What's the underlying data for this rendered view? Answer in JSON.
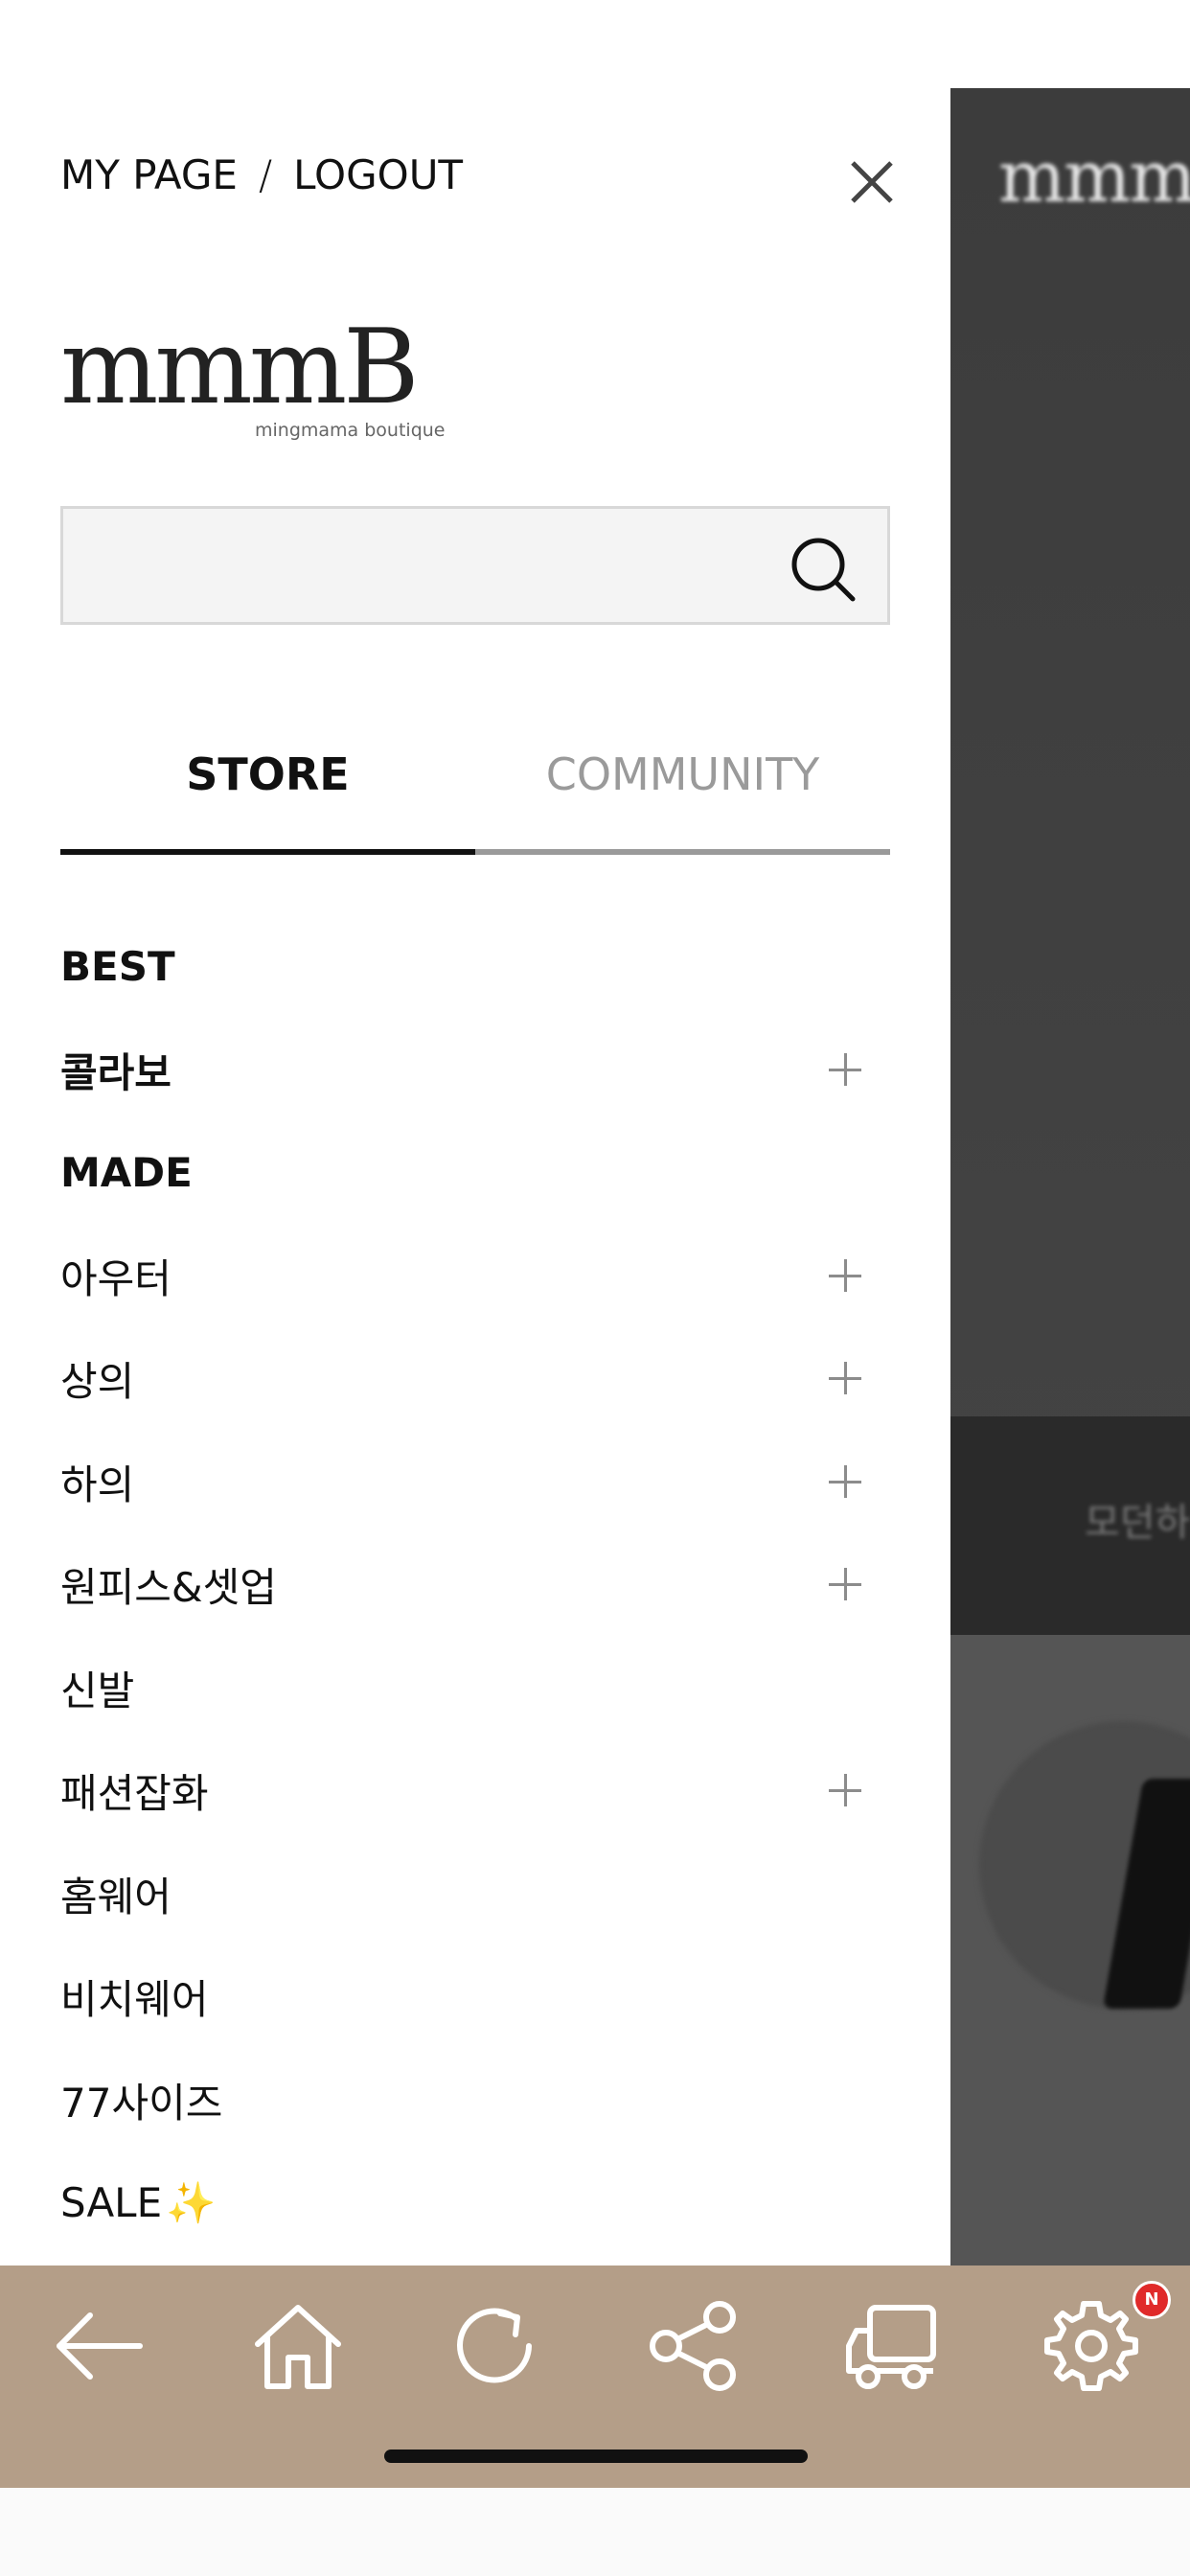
{
  "background_page": {
    "logo": "mmm",
    "band_text": "모던하"
  },
  "drawer": {
    "my_page": "MY PAGE",
    "separator": "/",
    "logout": "LOGOUT",
    "close_icon": "close-icon",
    "logo": {
      "main": "mmmB",
      "sub": "mingmama boutique"
    },
    "search": {
      "value": "",
      "placeholder": "",
      "icon": "search-icon"
    },
    "tabs": [
      {
        "label": "STORE",
        "active": true
      },
      {
        "label": "COMMUNITY",
        "active": false
      }
    ],
    "menu": [
      {
        "label": "BEST",
        "bold": true,
        "expandable": false
      },
      {
        "label": "콜라보",
        "bold": true,
        "expandable": true
      },
      {
        "label": "MADE",
        "bold": true,
        "expandable": false
      },
      {
        "label": "아우터",
        "bold": false,
        "expandable": true
      },
      {
        "label": "상의",
        "bold": false,
        "expandable": true
      },
      {
        "label": "하의",
        "bold": false,
        "expandable": true
      },
      {
        "label": "원피스&셋업",
        "bold": false,
        "expandable": true
      },
      {
        "label": "신발",
        "bold": false,
        "expandable": false
      },
      {
        "label": "패션잡화",
        "bold": false,
        "expandable": true
      },
      {
        "label": "홈웨어",
        "bold": false,
        "expandable": false
      },
      {
        "label": "비치웨어",
        "bold": false,
        "expandable": false
      },
      {
        "label": "77사이즈",
        "bold": false,
        "expandable": false
      },
      {
        "label": "SALE",
        "bold": false,
        "expandable": false,
        "suffix": "✨"
      }
    ]
  },
  "toolbar": {
    "buttons": [
      "back-arrow-icon",
      "home-icon",
      "refresh-icon",
      "share-icon",
      "delivery-truck-icon",
      "settings-gear-icon"
    ],
    "badge": "N"
  },
  "colors": {
    "toolbar_bg": "#b49e88",
    "badge": "#e02a2a",
    "active_tab": "#111111",
    "inactive_tab": "#9a9a9a"
  }
}
